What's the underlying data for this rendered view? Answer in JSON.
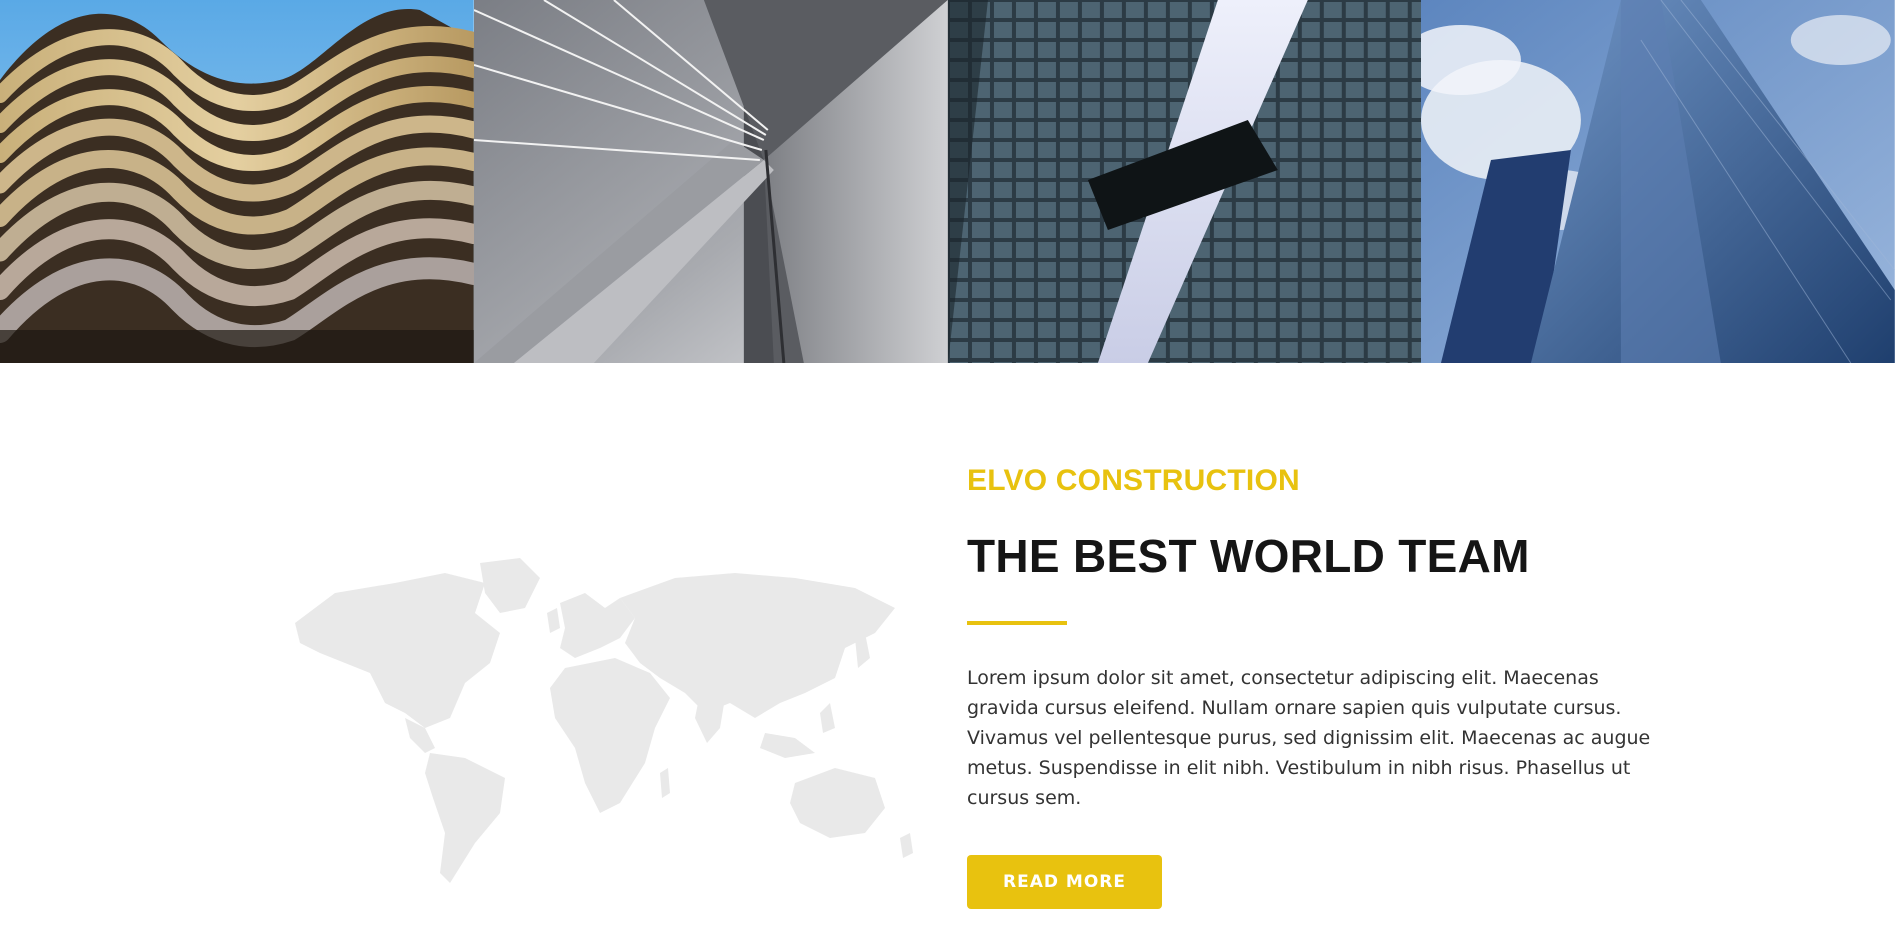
{
  "gallery": {
    "images": [
      {
        "alt": "wavy-balcony-building-photo"
      },
      {
        "alt": "cable-bridge-pylon-photo"
      },
      {
        "alt": "glass-towers-skybridge-photo"
      },
      {
        "alt": "blue-glass-skyscraper-photo"
      }
    ]
  },
  "about": {
    "eyebrow": "ELVO CONSTRUCTION",
    "headline": "THE BEST WORLD TEAM",
    "body": "Lorem ipsum dolor sit amet, consectetur adipiscing elit. Maecenas gravida cursus eleifend. Nullam ornare sapien quis vulputate cursus. Vivamus vel pellentesque purus, sed dignissim elit. Maecenas ac augue metus. Suspendisse in elit nibh. Vestibulum in nibh risus. Phasellus ut cursus sem.",
    "cta_label": "READ MORE"
  },
  "colors": {
    "accent": "#e8c20f",
    "heading": "#151515",
    "body_text": "#333333",
    "map_fill": "#e9e9e9"
  }
}
